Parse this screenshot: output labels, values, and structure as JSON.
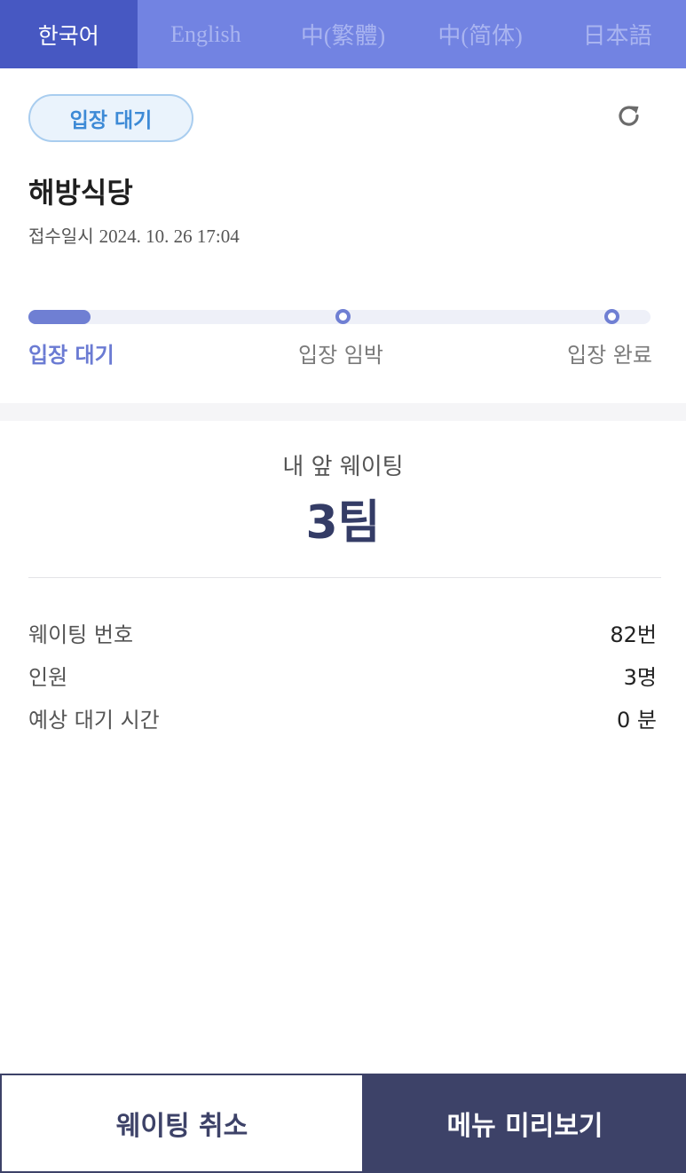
{
  "language_tabs": [
    {
      "label": "한국어",
      "active": true
    },
    {
      "label": "English",
      "active": false
    },
    {
      "label": "中(繁體)",
      "active": false
    },
    {
      "label": "中(简体)",
      "active": false
    },
    {
      "label": "日本語",
      "active": false
    }
  ],
  "status": {
    "badge_label": "입장 대기",
    "refresh_icon": "refresh-icon"
  },
  "restaurant": {
    "name": "해방식당",
    "received_label": "접수일시",
    "received_value": "2024. 10. 26 17:04"
  },
  "progress": {
    "steps": [
      "입장 대기",
      "입장 임박",
      "입장 완료"
    ],
    "current_step": 0,
    "fill_fraction": 0.1
  },
  "waiting": {
    "ahead_label": "내 앞 웨이팅",
    "ahead_value": "3팀"
  },
  "details": [
    {
      "label": "웨이팅 번호",
      "value": "82번"
    },
    {
      "label": "인원",
      "value": "3명"
    },
    {
      "label": "예상 대기 시간",
      "value": "0 분"
    }
  ],
  "actions": {
    "cancel_label": "웨이팅 취소",
    "menu_label": "메뉴 미리보기"
  },
  "colors": {
    "tab_bar": "#7283e2",
    "tab_active": "#4758c2",
    "accent": "#6f7fd3",
    "badge_text": "#3d8ad6",
    "dark_button": "#3d4268"
  }
}
